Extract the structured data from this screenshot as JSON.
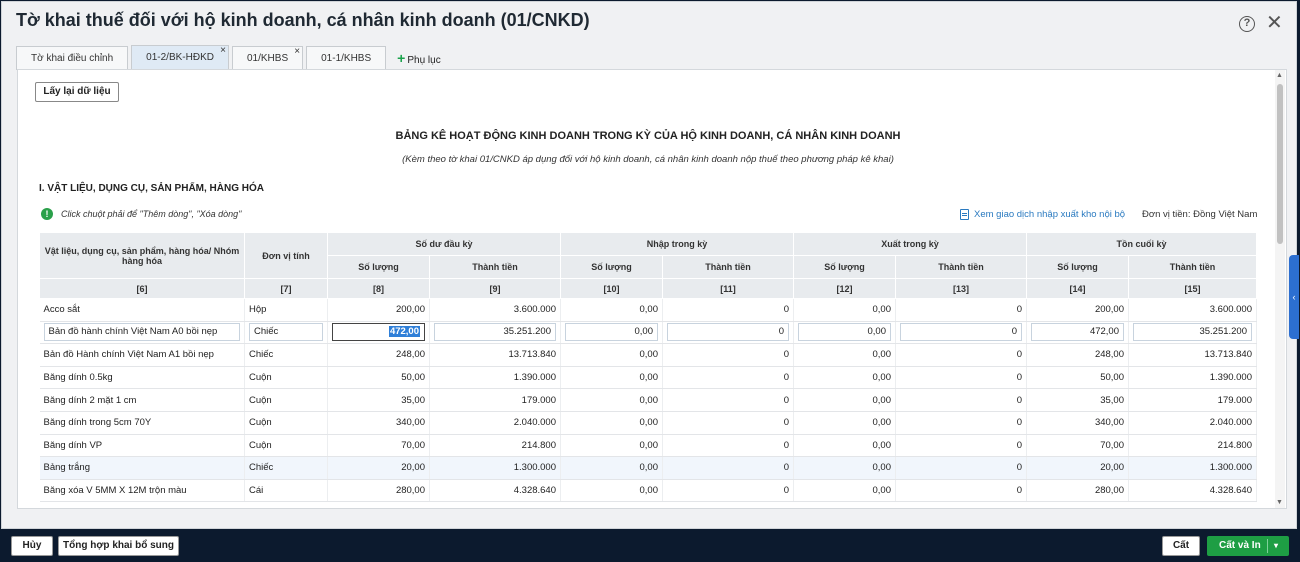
{
  "dialog": {
    "title": "Tờ khai thuế đối với hộ kinh doanh, cá nhân kinh doanh (01/CNKD)",
    "help_icon": "?",
    "close_icon": "✕"
  },
  "tabs": [
    {
      "label": "Tờ khai điều chỉnh",
      "closable": false,
      "active": false
    },
    {
      "label": "01-2/BK-HĐKD",
      "closable": true,
      "active": true
    },
    {
      "label": "01/KHBS",
      "closable": true,
      "active": false
    },
    {
      "label": "01-1/KHBS",
      "closable": false,
      "active": false
    }
  ],
  "tab_close_icon": "×",
  "add_tab": {
    "icon": "+",
    "label": "Phụ lục"
  },
  "reload_button": "Lấy lại dữ liệu",
  "sheet": {
    "title": "BẢNG KÊ HOẠT ĐỘNG KINH DOANH TRONG KỲ CỦA HỘ KINH DOANH, CÁ NHÂN KINH DOANH",
    "subtitle": "(Kèm theo tờ khai 01/CNKD áp dụng đối với hộ kinh doanh, cá nhân kinh doanh nộp thuế theo phương pháp kê khai)",
    "section": "I. VẬT LIỆU, DỤNG CỤ, SẢN PHẨM, HÀNG HÓA",
    "hint_icon": "!",
    "hint": "Click chuột phải để \"Thêm dòng\", \"Xóa dòng\"",
    "link": "Xem giao dịch nhập xuất kho nội bộ",
    "currency": "Đơn vị tiền: Đồng Việt Nam"
  },
  "table": {
    "col_item": "Vật liệu, dụng cụ, sản phẩm, hàng hóa/ Nhóm hàng hóa",
    "col_unit": "Đơn vị tính",
    "groups": [
      "Số dư đầu kỳ",
      "Nhập trong kỳ",
      "Xuất trong kỳ",
      "Tồn cuối kỳ"
    ],
    "qty": "Số lượng",
    "amount": "Thành tiền",
    "codes": [
      "[6]",
      "[7]",
      "[8]",
      "[9]",
      "[10]",
      "[11]",
      "[12]",
      "[13]",
      "[14]",
      "[15]"
    ],
    "rows": [
      [
        "Acco sắt",
        "Hộp",
        "200,00",
        "3.600.000",
        "0,00",
        "0",
        "0,00",
        "0",
        "200,00",
        "3.600.000"
      ],
      [
        "Bản đồ hành chính Việt Nam A0 bồi nẹp",
        "Chiếc",
        "472,00",
        "35.251.200",
        "0,00",
        "0",
        "0,00",
        "0",
        "472,00",
        "35.251.200"
      ],
      [
        "Bản đồ Hành chính Việt Nam A1 bồi nẹp",
        "Chiếc",
        "248,00",
        "13.713.840",
        "0,00",
        "0",
        "0,00",
        "0",
        "248,00",
        "13.713.840"
      ],
      [
        "Băng dính 0.5kg",
        "Cuộn",
        "50,00",
        "1.390.000",
        "0,00",
        "0",
        "0,00",
        "0",
        "50,00",
        "1.390.000"
      ],
      [
        "Băng dính 2 mặt 1 cm",
        "Cuộn",
        "35,00",
        "179.000",
        "0,00",
        "0",
        "0,00",
        "0",
        "35,00",
        "179.000"
      ],
      [
        "Băng dính trong 5cm 70Y",
        "Cuộn",
        "340,00",
        "2.040.000",
        "0,00",
        "0",
        "0,00",
        "0",
        "340,00",
        "2.040.000"
      ],
      [
        "Băng dính VP",
        "Cuộn",
        "70,00",
        "214.800",
        "0,00",
        "0",
        "0,00",
        "0",
        "70,00",
        "214.800"
      ],
      [
        "Bảng trắng",
        "Chiếc",
        "20,00",
        "1.300.000",
        "0,00",
        "0",
        "0,00",
        "0",
        "20,00",
        "1.300.000"
      ],
      [
        "Băng xóa V 5MM X 12M trộn màu",
        "Cái",
        "280,00",
        "4.328.640",
        "0,00",
        "0",
        "0,00",
        "0",
        "280,00",
        "4.328.640"
      ]
    ],
    "editing_row": 1,
    "hover_row": 7
  },
  "footer": {
    "cancel": "Hủy",
    "summary": "Tổng hợp khai bổ sung",
    "save": "Cất",
    "save_print": "Cất và In",
    "save_print_caret": "▾"
  },
  "colors": {
    "accent_green": "#1e9e44",
    "link_blue": "#2a7ac0",
    "header_gray": "#e8ebee",
    "footer_bg": "#0c1a2e"
  }
}
